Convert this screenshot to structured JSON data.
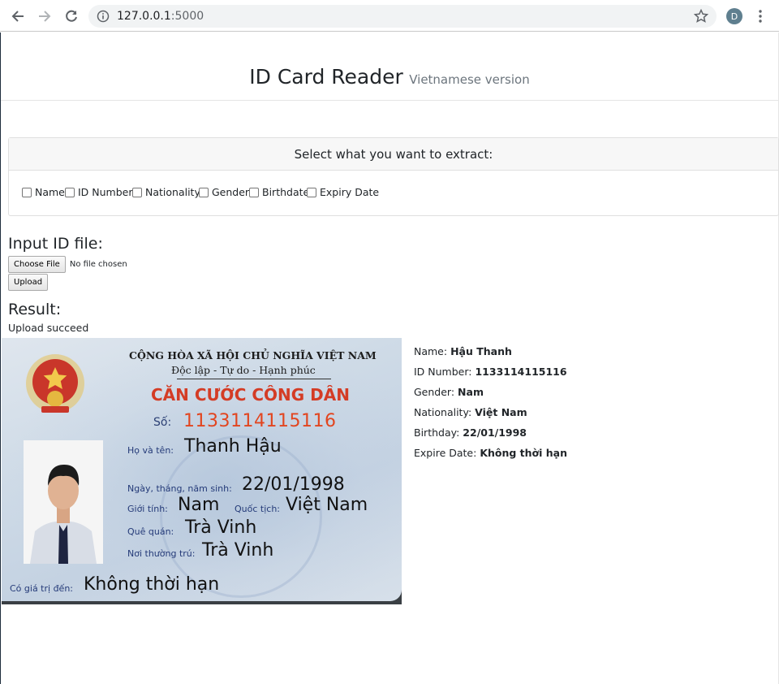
{
  "browser": {
    "url_host": "127.0.0.1",
    "url_port": ":5000",
    "profile_initial": "D"
  },
  "header": {
    "title": "ID Card Reader",
    "subtitle": "Vietnamese version"
  },
  "extract_card": {
    "title": "Select what you want to extract:",
    "options": [
      {
        "label": "Name",
        "checked": false
      },
      {
        "label": "ID Number",
        "checked": false
      },
      {
        "label": "Nationality",
        "checked": false
      },
      {
        "label": "Gender",
        "checked": false
      },
      {
        "label": "Birthdate",
        "checked": false
      },
      {
        "label": "Expiry Date",
        "checked": false
      }
    ]
  },
  "input_section": {
    "heading": "Input ID file:",
    "choose_file_label": "Choose File",
    "file_status": "No file chosen",
    "upload_label": "Upload"
  },
  "result_section": {
    "heading": "Result:",
    "status": "Upload succeed"
  },
  "id_card_image": {
    "republic": "CỘNG HÒA XÃ HỘI CHỦ NGHĨA VIỆT NAM",
    "motto": "Độc lập - Tự do - Hạnh phúc",
    "card_title": "CĂN CƯỚC CÔNG DÂN",
    "so_label": "Số:",
    "number": "1133114115116",
    "name_label": "Họ và tên:",
    "name": "Thanh Hậu",
    "dob_label": "Ngày, tháng, năm sinh:",
    "dob": "22/01/1998",
    "gender_label": "Giới tính:",
    "gender": "Nam",
    "nationality_label": "Quốc tịch:",
    "nationality": "Việt Nam",
    "hometown_label": "Quê quán:",
    "hometown": "Trà Vinh",
    "residence_label": "Nơi thường trú:",
    "residence": "Trà Vinh",
    "expiry_label": "Có giá trị đến:",
    "expiry": "Không thời hạn"
  },
  "results": [
    {
      "label": "Name:",
      "value": "Hậu Thanh"
    },
    {
      "label": "ID Number:",
      "value": "1133114115116"
    },
    {
      "label": "Gender:",
      "value": "Nam"
    },
    {
      "label": "Nationality:",
      "value": "Việt Nam"
    },
    {
      "label": "Birthday:",
      "value": "22/01/1998"
    },
    {
      "label": "Expire Date:",
      "value": "Không thời hạn"
    }
  ]
}
